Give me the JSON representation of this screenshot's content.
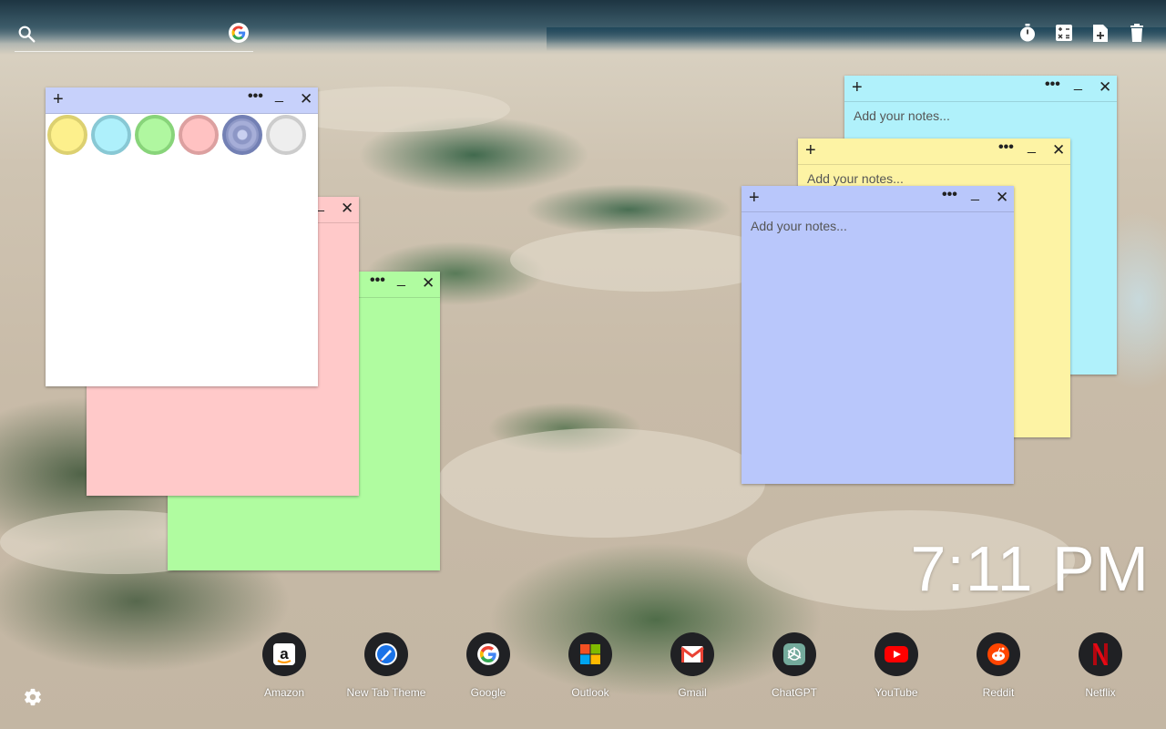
{
  "search": {
    "placeholder": "",
    "value": ""
  },
  "engine_icon": "google-g-icon",
  "toolbar": [
    {
      "name": "timer-icon"
    },
    {
      "name": "calculator-icon"
    },
    {
      "name": "new-note-icon"
    },
    {
      "name": "trash-icon"
    }
  ],
  "notes": [
    {
      "color": "#ffffff",
      "placeholder": "",
      "palette_open": true
    },
    {
      "color": "#ffc9c9",
      "placeholder": ""
    },
    {
      "color": "#b0fca0",
      "placeholder": ""
    },
    {
      "color": "#b0f1fb",
      "placeholder": "Add your notes..."
    },
    {
      "color": "#fdf3a4",
      "placeholder": "Add your notes..."
    },
    {
      "color": "#b9c7fb",
      "placeholder": "Add your notes..."
    }
  ],
  "palette": [
    {
      "name": "yellow",
      "fill": "#fdf08c",
      "ring": "#dcd070"
    },
    {
      "name": "cyan",
      "fill": "#aef0fb",
      "ring": "#88c8d4"
    },
    {
      "name": "green",
      "fill": "#b0f7a0",
      "ring": "#88d47a"
    },
    {
      "name": "pink",
      "fill": "#ffc2c2",
      "ring": "#dca0a0"
    },
    {
      "name": "blue",
      "fill": "#8d97c6",
      "ring": "#7380b4",
      "selected": true
    },
    {
      "name": "white",
      "fill": "#eeeeee",
      "ring": "#cccccc"
    }
  ],
  "note_controls": {
    "add": "+",
    "menu": "•••",
    "minimize": "_",
    "close": "✕"
  },
  "clock": {
    "time": "7:11 PM"
  },
  "shortcuts": [
    {
      "label": "Amazon",
      "icon": "amazon-icon"
    },
    {
      "label": "New Tab Theme",
      "icon": "new-tab-theme-icon"
    },
    {
      "label": "Google",
      "icon": "google-icon"
    },
    {
      "label": "Outlook",
      "icon": "outlook-icon"
    },
    {
      "label": "Gmail",
      "icon": "gmail-icon"
    },
    {
      "label": "ChatGPT",
      "icon": "chatgpt-icon"
    },
    {
      "label": "YouTube",
      "icon": "youtube-icon"
    },
    {
      "label": "Reddit",
      "icon": "reddit-icon"
    },
    {
      "label": "Netflix",
      "icon": "netflix-icon"
    }
  ],
  "settings_icon": "settings-gear-icon"
}
